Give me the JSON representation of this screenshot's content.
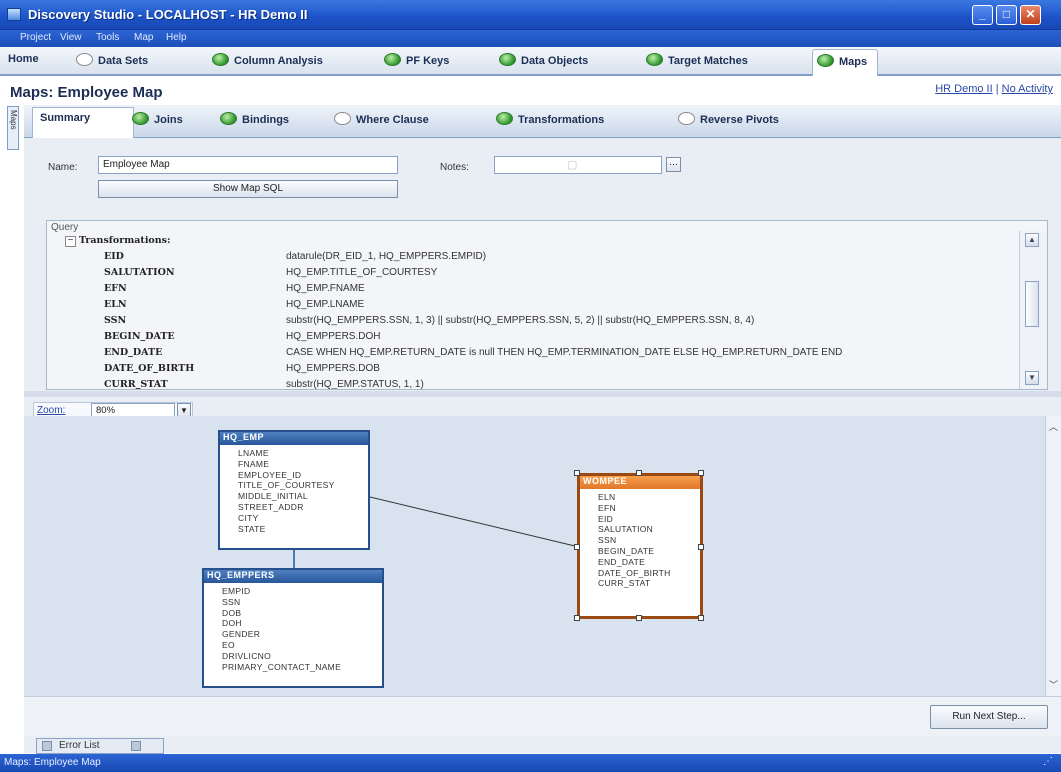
{
  "window": {
    "title": "Discovery Studio - LOCALHOST - HR Demo II"
  },
  "menu": [
    "Project",
    "View",
    "Tools",
    "Map",
    "Help"
  ],
  "tabs": [
    {
      "label": "Home",
      "state": "none"
    },
    {
      "label": "Data Sets",
      "state": "empty"
    },
    {
      "label": "Column Analysis",
      "state": "green"
    },
    {
      "label": "PF Keys",
      "state": "green"
    },
    {
      "label": "Data Objects",
      "state": "green"
    },
    {
      "label": "Target Matches",
      "state": "green"
    },
    {
      "label": "Maps",
      "state": "green",
      "active": true
    }
  ],
  "page": {
    "title": "Maps: Employee Map",
    "link_project": "HR Demo II",
    "link_activity": "No Activity",
    "side_tab": "Maps"
  },
  "subtabs": [
    {
      "label": "Summary",
      "state": "none",
      "active": true
    },
    {
      "label": "Joins",
      "state": "green"
    },
    {
      "label": "Bindings",
      "state": "green"
    },
    {
      "label": "Where Clause",
      "state": "empty"
    },
    {
      "label": "Transformations",
      "state": "green"
    },
    {
      "label": "Reverse Pivots",
      "state": "empty"
    }
  ],
  "form": {
    "name_label": "Name:",
    "name_value": "Employee Map",
    "show_sql_button": "Show Map SQL",
    "notes_label": "Notes:",
    "notes_value": ""
  },
  "query": {
    "group_label": "Query",
    "section": "Transformations:",
    "rows": [
      {
        "key": "EID",
        "value": "datarule(DR_EID_1, HQ_EMPPERS.EMPID)"
      },
      {
        "key": "SALUTATION",
        "value": "HQ_EMP.TITLE_OF_COURTESY"
      },
      {
        "key": "EFN",
        "value": "HQ_EMP.FNAME"
      },
      {
        "key": "ELN",
        "value": "HQ_EMP.LNAME"
      },
      {
        "key": "SSN",
        "value": "substr(HQ_EMPPERS.SSN, 1, 3) || substr(HQ_EMPPERS.SSN, 5, 2) || substr(HQ_EMPPERS.SSN, 8, 4)"
      },
      {
        "key": "BEGIN_DATE",
        "value": "HQ_EMPPERS.DOH"
      },
      {
        "key": "END_DATE",
        "value": "CASE WHEN HQ_EMP.RETURN_DATE is null THEN HQ_EMP.TERMINATION_DATE ELSE HQ_EMP.RETURN_DATE END"
      },
      {
        "key": "DATE_OF_BIRTH",
        "value": "HQ_EMPPERS.DOB"
      },
      {
        "key": "CURR_STAT",
        "value": "substr(HQ_EMP.STATUS, 1, 1)"
      }
    ]
  },
  "zoom": {
    "label": "Zoom:",
    "value": "80%"
  },
  "diagram": {
    "tables": [
      {
        "name": "HQ_EMP",
        "fields": [
          "LNAME",
          "FNAME",
          "EMPLOYEE_ID",
          "TITLE_OF_COURTESY",
          "MIDDLE_INITIAL",
          "STREET_ADDR",
          "CITY",
          "STATE"
        ]
      },
      {
        "name": "HQ_EMPPERS",
        "fields": [
          "EMPID",
          "SSN",
          "DOB",
          "DOH",
          "GENDER",
          "EO",
          "DRIVLICNO",
          "PRIMARY_CONTACT_NAME"
        ]
      },
      {
        "name": "WOMPEE",
        "fields": [
          "ELN",
          "EFN",
          "EID",
          "SALUTATION",
          "SSN",
          "BEGIN_DATE",
          "END_DATE",
          "DATE_OF_BIRTH",
          "CURR_STAT"
        ]
      }
    ]
  },
  "bottom": {
    "run_next_step": "Run Next Step...",
    "error_list": "Error List"
  },
  "status": {
    "text": "Maps: Employee Map"
  },
  "colors": {
    "title_blue": "#1c52c8",
    "tab_green": "#3ea23a",
    "target_orange": "#e0762a"
  }
}
